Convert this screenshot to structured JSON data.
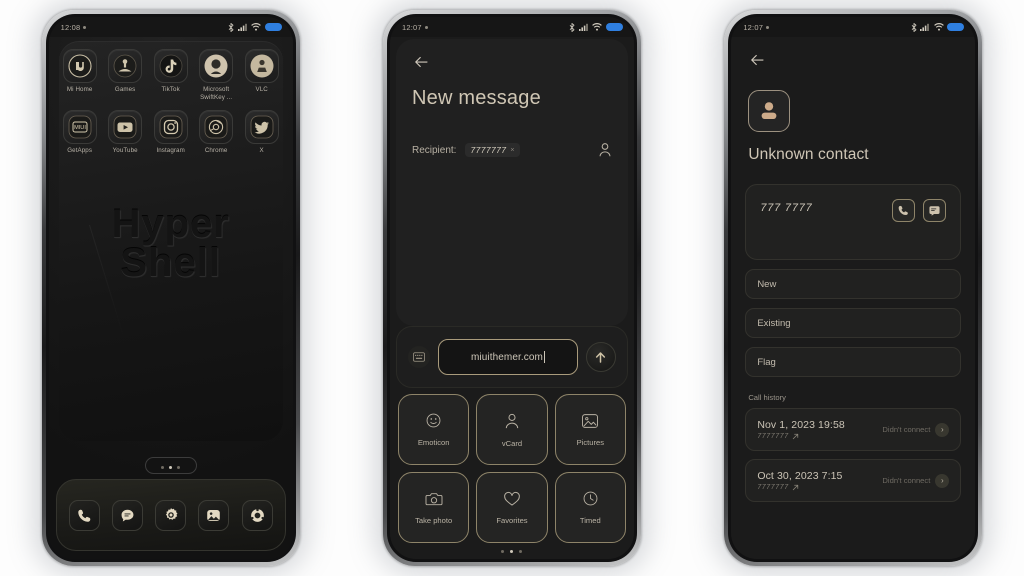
{
  "colors": {
    "accent_gold": "#a99b7c",
    "text_primary": "#cfc6b4",
    "text_secondary": "#b7b0a3",
    "text_muted": "#7e7a71",
    "screen_bg": "#1b1b1b",
    "battery_blue": "#2f7fe0",
    "avatar_tan": "#cdab8a"
  },
  "phone1": {
    "status_bar": {
      "time": "12:08",
      "icons": [
        "bluetooth-icon",
        "signal-icon",
        "wifi-icon",
        "battery-icon"
      ]
    },
    "wallpaper": {
      "line1": "Hyper",
      "line2": "Shell"
    },
    "apps_row1": [
      {
        "label": "Mi Home",
        "icon": "mi-home-icon"
      },
      {
        "label": "Games",
        "icon": "games-icon"
      },
      {
        "label": "TikTok",
        "icon": "tiktok-icon"
      },
      {
        "label": "Microsoft SwiftKey ...",
        "icon": "swiftkey-icon"
      },
      {
        "label": "VLC",
        "icon": "vlc-icon"
      }
    ],
    "apps_row2": [
      {
        "label": "GetApps",
        "icon": "getapps-icon"
      },
      {
        "label": "YouTube",
        "icon": "youtube-icon"
      },
      {
        "label": "Instagram",
        "icon": "instagram-icon"
      },
      {
        "label": "Chrome",
        "icon": "chrome-icon"
      },
      {
        "label": "X",
        "icon": "x-twitter-icon"
      }
    ],
    "page_dots": {
      "count": 3,
      "active": 1
    },
    "dock": [
      {
        "icon": "phone-icon"
      },
      {
        "icon": "messages-icon"
      },
      {
        "icon": "settings-gear-icon"
      },
      {
        "icon": "gallery-icon"
      },
      {
        "icon": "camera-icon"
      }
    ]
  },
  "phone2": {
    "status_bar": {
      "time": "12:07",
      "icons": [
        "bluetooth-icon",
        "signal-icon",
        "wifi-icon",
        "battery-icon"
      ]
    },
    "back_icon": "back-arrow-icon",
    "title": "New message",
    "recipient_label": "Recipient:",
    "recipient_value": "7777777",
    "recipient_remove": "×",
    "contact_picker_icon": "person-icon",
    "compose": {
      "keyboard_icon": "keyboard-icon",
      "input_value": "miuithemer.com",
      "send_icon": "send-up-arrow-icon"
    },
    "attachments": [
      {
        "label": "Emoticon",
        "icon": "smiley-icon"
      },
      {
        "label": "vCard",
        "icon": "person-icon"
      },
      {
        "label": "Pictures",
        "icon": "image-icon"
      },
      {
        "label": "Take photo",
        "icon": "camera-icon"
      },
      {
        "label": "Favorites",
        "icon": "heart-icon"
      },
      {
        "label": "Timed",
        "icon": "clock-icon"
      }
    ],
    "page_dots": {
      "count": 3,
      "active": 1
    }
  },
  "phone3": {
    "status_bar": {
      "time": "12:07",
      "icons": [
        "bluetooth-icon",
        "signal-icon",
        "wifi-icon",
        "battery-icon"
      ]
    },
    "back_icon": "back-arrow-icon",
    "avatar_icon": "person-avatar-icon",
    "contact_name": "Unknown contact",
    "phone_number": "777 7777",
    "card_actions": [
      {
        "icon": "call-icon"
      },
      {
        "icon": "message-icon"
      }
    ],
    "options": [
      {
        "label": "New"
      },
      {
        "label": "Existing"
      },
      {
        "label": "Flag"
      }
    ],
    "call_history_title": "Call history",
    "call_history": [
      {
        "date": "Nov 1, 2023 19:58",
        "number": "7777777",
        "direction_icon": "outgoing-call-icon",
        "status": "Didn't connect",
        "chevron": "chevron-right-icon"
      },
      {
        "date": "Oct 30, 2023 7:15",
        "number": "7777777",
        "direction_icon": "outgoing-call-icon",
        "status": "Didn't connect",
        "chevron": "chevron-right-icon"
      }
    ]
  }
}
